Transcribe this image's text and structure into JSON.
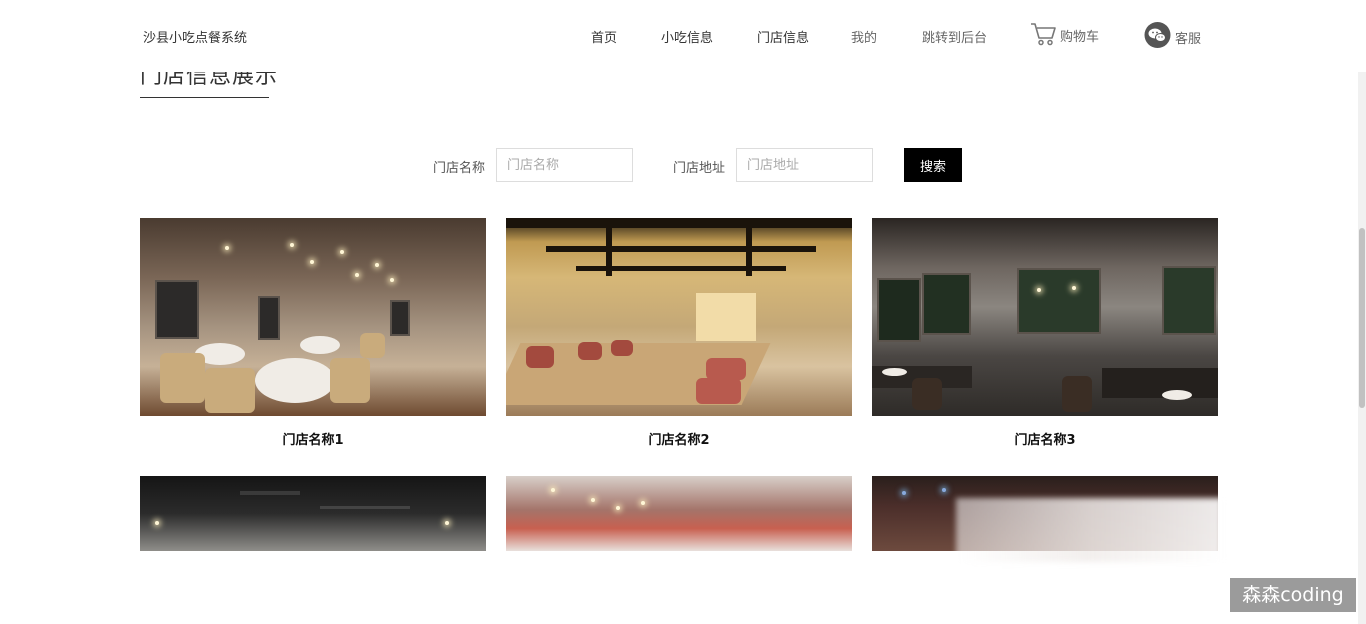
{
  "header": {
    "brand": "沙县小吃点餐系统",
    "nav": {
      "home": "首页",
      "snacks": "小吃信息",
      "stores": "门店信息",
      "mine": "我的",
      "admin": "跳转到后台",
      "cart": "购物车",
      "service": "客服"
    },
    "icons": {
      "cart": "cart-icon",
      "service": "wechat-icon"
    }
  },
  "section": {
    "title": "门店信息展示"
  },
  "search": {
    "name_label": "门店名称",
    "name_placeholder": "门店名称",
    "name_value": "",
    "address_label": "门店地址",
    "address_placeholder": "门店地址",
    "address_value": "",
    "button_label": "搜索"
  },
  "stores": [
    {
      "name": "门店名称1"
    },
    {
      "name": "门店名称2"
    },
    {
      "name": "门店名称3"
    }
  ],
  "watermark": "森森coding"
}
